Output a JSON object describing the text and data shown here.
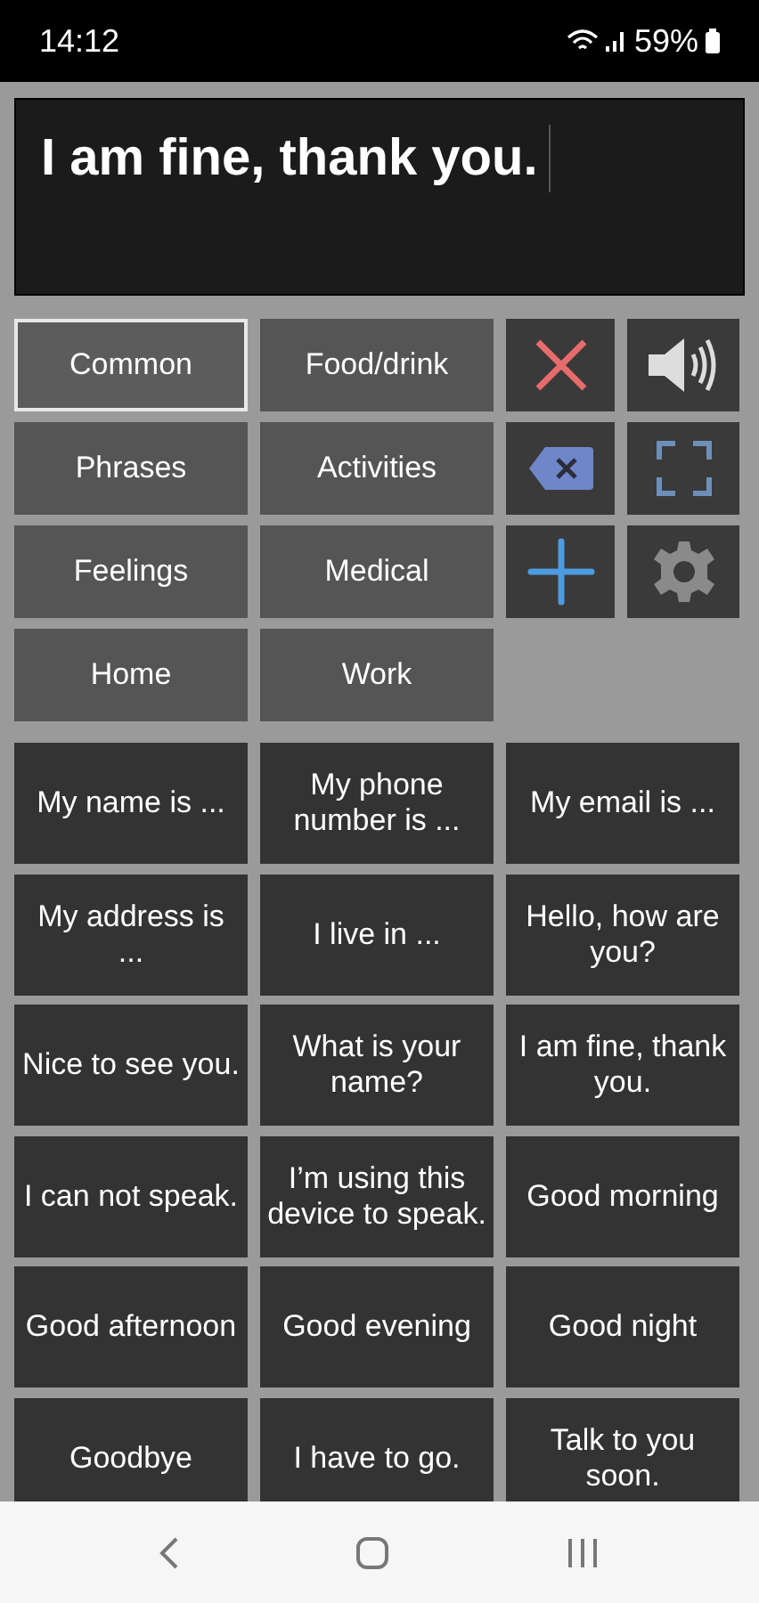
{
  "status_bar": {
    "time": "14:12",
    "battery": "59%"
  },
  "message": {
    "value": "I am fine, thank you."
  },
  "categories": [
    {
      "label": "Common",
      "selected": true
    },
    {
      "label": "Food/drink",
      "selected": false
    },
    {
      "label": "Phrases",
      "selected": false
    },
    {
      "label": "Activities",
      "selected": false
    },
    {
      "label": "Feelings",
      "selected": false
    },
    {
      "label": "Medical",
      "selected": false
    },
    {
      "label": "Home",
      "selected": false
    },
    {
      "label": "Work",
      "selected": false
    }
  ],
  "phrases": [
    "My name is ...",
    "My phone number is ...",
    "My email is ...",
    "My address is ...",
    "I live in ...",
    "Hello, how are you?",
    "Nice to see you.",
    "What is your name?",
    "I am fine, thank you.",
    "I can not speak.",
    "I’m using this device to speak.",
    "Good morning",
    "Good afternoon",
    "Good evening",
    "Good night",
    "Goodbye",
    "I have to go.",
    "Talk to you soon."
  ]
}
